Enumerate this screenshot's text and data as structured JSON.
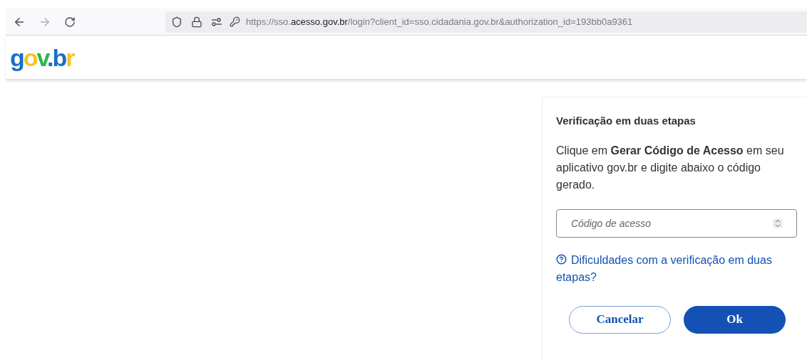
{
  "browser": {
    "back_disabled": false,
    "forward_disabled": true,
    "url_parts": [
      {
        "text": "https://sso.",
        "emphasis": false
      },
      {
        "text": "acesso.gov.br",
        "emphasis": true
      },
      {
        "text": "/login?client_id=sso.cidadania.gov.br&authorization_id=193bb0a9361",
        "emphasis": false
      }
    ]
  },
  "logo": {
    "letters": [
      {
        "text": "g",
        "color": "#1a6fc4"
      },
      {
        "text": "o",
        "color": "#fcc21b"
      },
      {
        "text": "v",
        "color": "#2fb34a"
      },
      {
        "text": ".",
        "color": "#1a6fc4"
      },
      {
        "text": "b",
        "color": "#1a6fc4"
      },
      {
        "text": "r",
        "color": "#fcc21b"
      }
    ]
  },
  "panel": {
    "title": "Verificação em duas etapas",
    "instructions": "Clique em **Gerar Código de Acesso** em seu aplicativo gov.br e digite abaixo o código gerado.",
    "code_field": {
      "placeholder": "Código de acesso"
    },
    "help_link": "Dificuldades com a verificação em duas etapas?",
    "buttons": [
      {
        "label": "Cancelar",
        "kind": "secondary"
      },
      {
        "label": "Ok",
        "kind": "primary"
      }
    ]
  }
}
